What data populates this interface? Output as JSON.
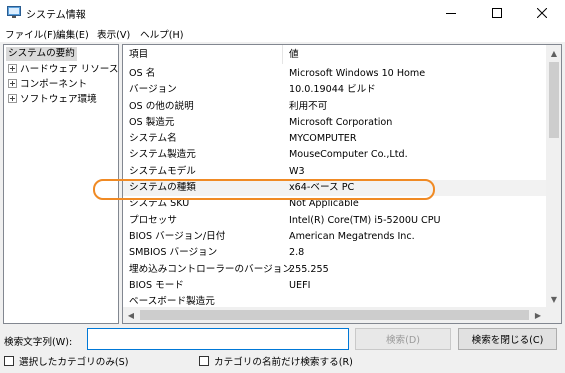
{
  "window": {
    "title": "システム情報"
  },
  "menu": [
    {
      "label": "ファイル(F)"
    },
    {
      "label": "編集(E)"
    },
    {
      "label": "表示(V)"
    },
    {
      "label": "ヘルプ(H)"
    }
  ],
  "tree": {
    "root": "システムの要約",
    "children": [
      "ハードウェア リソース",
      "コンポーネント",
      "ソフトウェア環境"
    ]
  },
  "list": {
    "headers": [
      "項目",
      "値"
    ],
    "rows": [
      [
        "OS 名",
        "Microsoft Windows 10 Home"
      ],
      [
        "バージョン",
        "10.0.19044 ビルド"
      ],
      [
        "OS の他の説明",
        "利用不可"
      ],
      [
        "OS 製造元",
        "Microsoft Corporation"
      ],
      [
        "システム名",
        "MYCOMPUTER"
      ],
      [
        "システム製造元",
        "MouseComputer Co.,Ltd."
      ],
      [
        "システムモデル",
        "W3"
      ],
      [
        "システムの種類",
        "x64-ベース PC"
      ],
      [
        "システム SKU",
        "Not Applicable"
      ],
      [
        "プロセッサ",
        "Intel(R) Core(TM) i5-5200U CPU"
      ],
      [
        "BIOS バージョン/日付",
        "American Megatrends Inc."
      ],
      [
        "SMBIOS バージョン",
        "2.8"
      ],
      [
        "埋め込みコントローラーのバージョン",
        "255.255"
      ],
      [
        "BIOS モード",
        "UEFI"
      ],
      [
        "ベースボード製造元",
        ""
      ]
    ],
    "highlighted_row": "システムの種類"
  },
  "search": {
    "label": "検索文字列(W):",
    "value": "",
    "search_button": "検索(D)",
    "close_button": "検索を閉じる(C)"
  },
  "options": {
    "selected_category_only": "選択したカテゴリのみ(S)",
    "category_names_only": "カテゴリの名前だけ検索する(R)"
  },
  "colors": {
    "highlight_outline": "#f08a24",
    "focus_border": "#0078d7"
  }
}
